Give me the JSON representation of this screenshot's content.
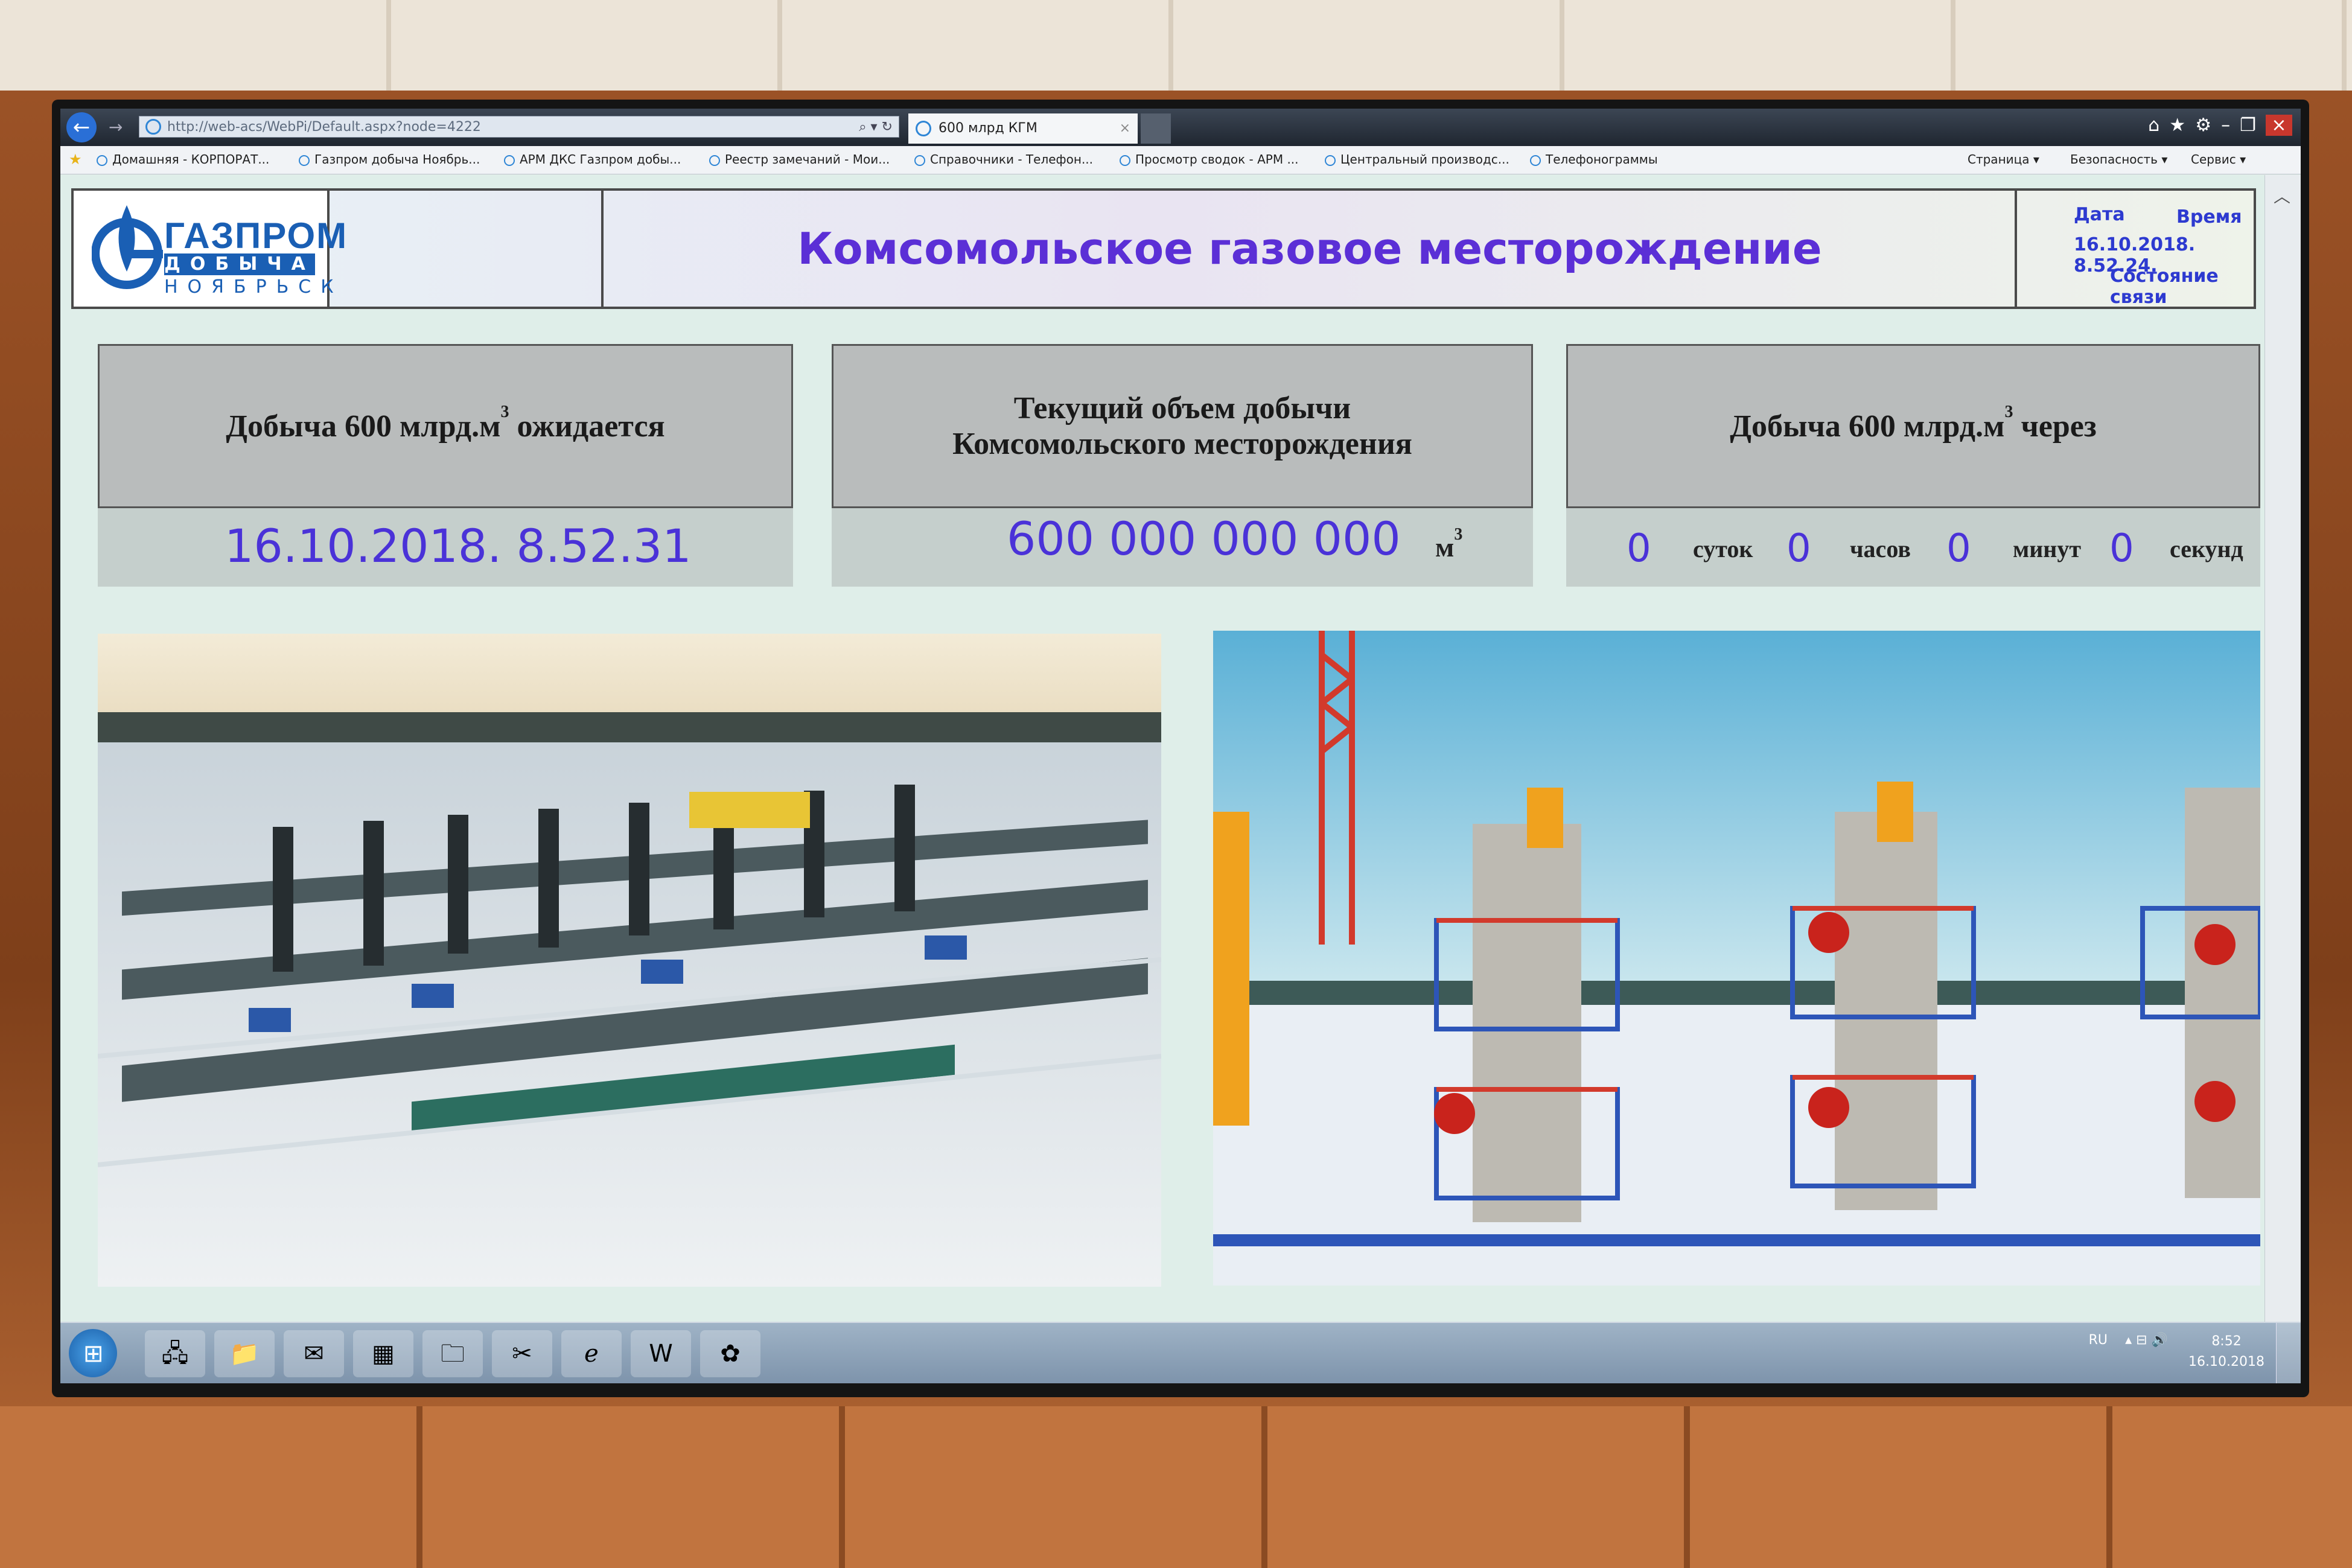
{
  "browser": {
    "address": "http://web-acs/WebPi/Default.aspx?node=4222",
    "active_tab": "600 млрд КГМ",
    "tab_close": "×",
    "favorites": [
      "Домашняя - КОРПОРАТ...",
      "Газпром добыча Ноябрь...",
      "АРМ ДКС Газпром добы...",
      "Реестр замечаний - Мои...",
      "Справочники - Телефон...",
      "Просмотр сводок - АРМ ...",
      "Центральный производс...",
      "Телефонограммы"
    ],
    "commands": [
      "Страница",
      "Безопасность",
      "Сервис"
    ]
  },
  "header": {
    "logo_line1": "ГАЗПРОМ",
    "logo_line2": "ДОБЫЧА",
    "logo_line3": "НОЯБРЬСК",
    "title": "Комсомольское газовое месторождение",
    "date_label": "Дата",
    "time_label": "Время",
    "datetime": "16.10.2018. 8.52.24.",
    "connection_label": "Состояние связи"
  },
  "panels": {
    "expected_label": "Добыча 600 млрд.м",
    "expected_label_tail": "ожидается",
    "expected_value": "16.10.2018. 8.52.31",
    "current_label_line1": "Текущий объем добычи",
    "current_label_line2": "Комсомольского месторождения",
    "current_value": "600 000 000 000",
    "current_unit": "м",
    "remaining_label": "Добыча 600 млрд.м",
    "remaining_label_tail": "через",
    "sup": "3",
    "countdown": [
      {
        "value": "0",
        "unit": "суток"
      },
      {
        "value": "0",
        "unit": "часов"
      },
      {
        "value": "0",
        "unit": "минут"
      },
      {
        "value": "0",
        "unit": "секунд"
      }
    ]
  },
  "taskbar": {
    "lang": "RU",
    "time": "8:52",
    "date": "16.10.2018"
  },
  "colors": {
    "title": "#5b2fd6",
    "value": "#4a32d8",
    "brand": "#1a5fb4",
    "status_ok": "#3bbf3b"
  }
}
